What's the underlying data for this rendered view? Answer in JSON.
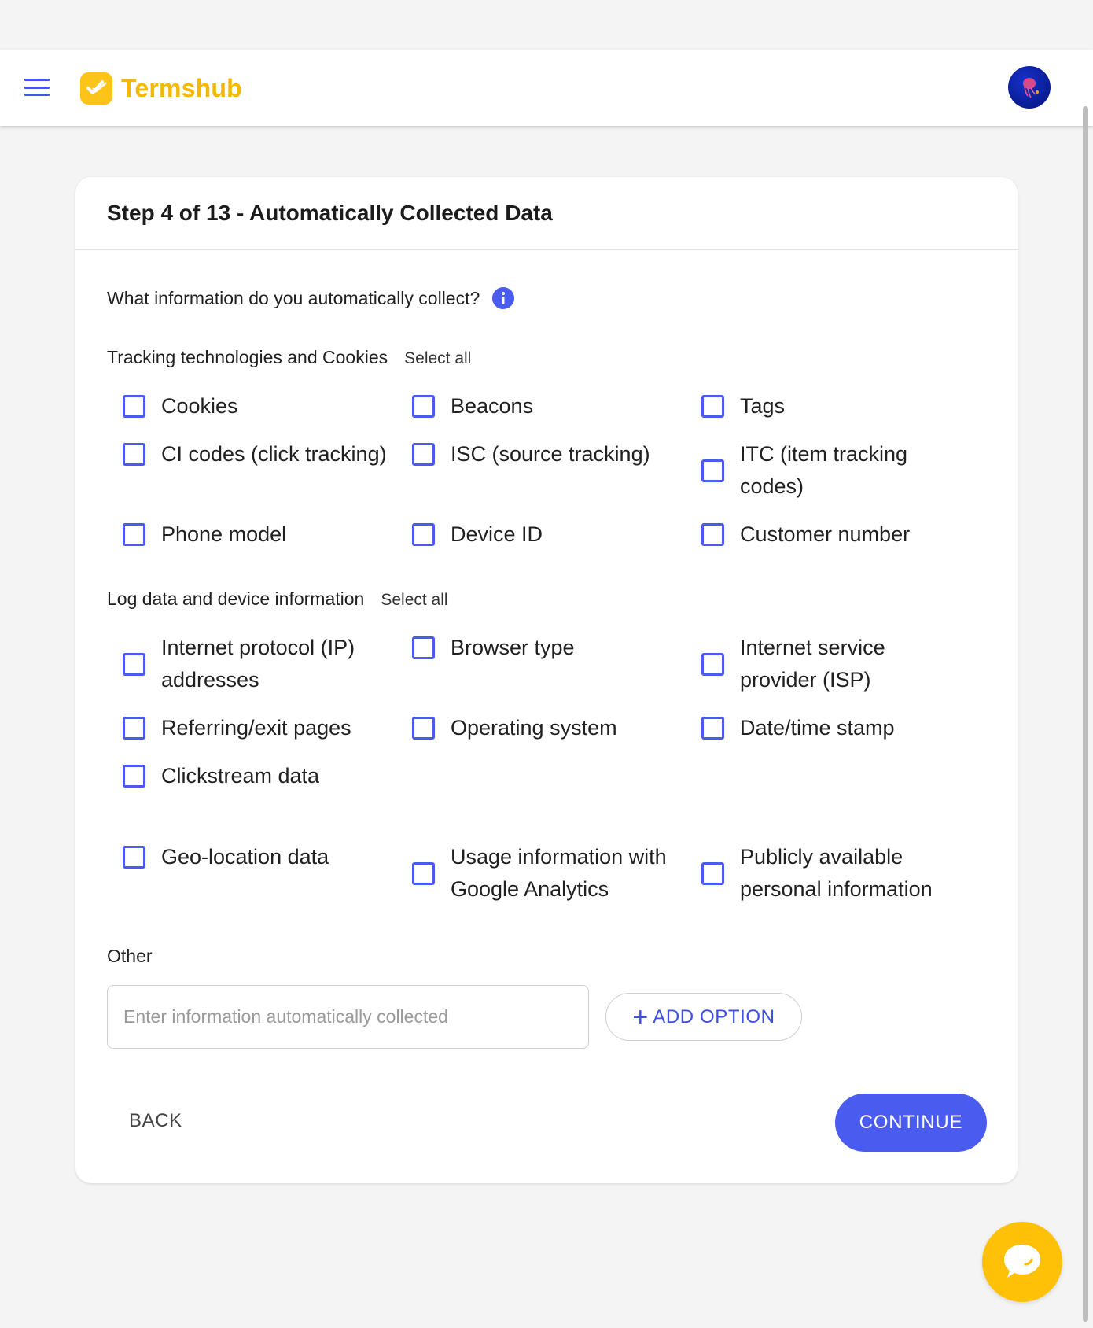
{
  "app": {
    "brand_name": "Termshub",
    "brand_color": "#fcc419",
    "accent_color": "#4a5cf0",
    "menu_icon": "hamburger-menu-icon",
    "avatar_icon": "jellyfish-avatar"
  },
  "step": {
    "title": "Step 4 of 13 - Automatically Collected Data",
    "question": "What information do you automatically collect?",
    "info_icon": "info-icon"
  },
  "sections": [
    {
      "title": "Tracking technologies and Cookies",
      "select_all": "Select all",
      "options": [
        {
          "label": "Cookies",
          "checked": false
        },
        {
          "label": "Beacons",
          "checked": false
        },
        {
          "label": "Tags",
          "checked": false
        },
        {
          "label": "CI codes (click tracking)",
          "checked": false
        },
        {
          "label": "ISC (source tracking)",
          "checked": false
        },
        {
          "label": "ITC (item tracking codes)",
          "checked": false
        },
        {
          "label": "Phone model",
          "checked": false
        },
        {
          "label": "Device ID",
          "checked": false
        },
        {
          "label": "Customer number",
          "checked": false
        }
      ]
    },
    {
      "title": "Log data and device information",
      "select_all": "Select all",
      "options": [
        {
          "label": "Internet protocol (IP) addresses",
          "checked": false
        },
        {
          "label": "Browser type",
          "checked": false
        },
        {
          "label": "Internet service provider (ISP)",
          "checked": false
        },
        {
          "label": "Referring/exit pages",
          "checked": false
        },
        {
          "label": "Operating system",
          "checked": false
        },
        {
          "label": "Date/time stamp",
          "checked": false
        },
        {
          "label": "Clickstream data",
          "checked": false
        }
      ]
    }
  ],
  "extra_options": [
    {
      "label": "Geo-location data",
      "checked": false
    },
    {
      "label": "Usage information with Google Analytics",
      "checked": false
    },
    {
      "label": "Publicly available personal information",
      "checked": false
    }
  ],
  "other": {
    "label": "Other",
    "value": "",
    "placeholder": "Enter information automatically collected",
    "add_option": "ADD OPTION"
  },
  "nav": {
    "back": "BACK",
    "continue": "CONTINUE"
  },
  "chat": {
    "icon": "chat-bubble-icon"
  }
}
